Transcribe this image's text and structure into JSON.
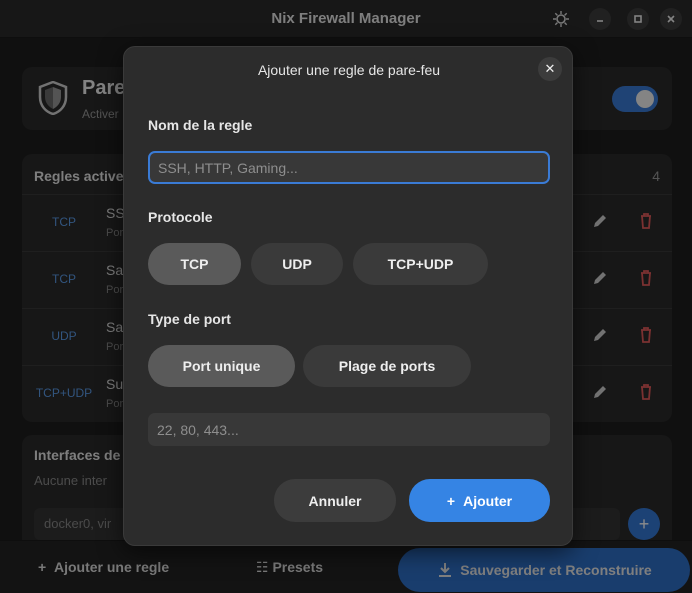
{
  "window": {
    "title": "Nix Firewall Manager"
  },
  "header": {
    "title": "Pare",
    "subtitle": "Activer"
  },
  "rules": {
    "title": "Regles active",
    "count": "4",
    "items": [
      {
        "protocol": "TCP",
        "name": "SS",
        "port": "Por"
      },
      {
        "protocol": "TCP",
        "name": "Sa",
        "port": "Por"
      },
      {
        "protocol": "UDP",
        "name": "Sa",
        "port": "Por"
      },
      {
        "protocol": "TCP+UDP",
        "name": "Su",
        "port": "Por"
      }
    ]
  },
  "interfaces": {
    "title": "Interfaces de",
    "subtitle": "Aucune inter",
    "input_placeholder": "docker0, vir"
  },
  "bottombar": {
    "add_label": "Ajouter une regle",
    "presets_label": "Presets",
    "save_label": "Sauvegarder et Reconstruire"
  },
  "dialog": {
    "title": "Ajouter une regle de pare-feu",
    "name_label": "Nom de la regle",
    "name_placeholder": "SSH, HTTP, Gaming...",
    "protocol_label": "Protocole",
    "protocols": [
      "TCP",
      "UDP",
      "TCP+UDP"
    ],
    "selected_protocol": "TCP",
    "port_type_label": "Type de port",
    "port_types": [
      "Port unique",
      "Plage de ports"
    ],
    "selected_port_type": "Port unique",
    "port_placeholder": "22, 80, 443...",
    "cancel_label": "Annuler",
    "add_label": "Ajouter"
  },
  "colors": {
    "accent": "#3584e4",
    "danger": "#e05a5a",
    "protocol": "#5b9be8"
  }
}
